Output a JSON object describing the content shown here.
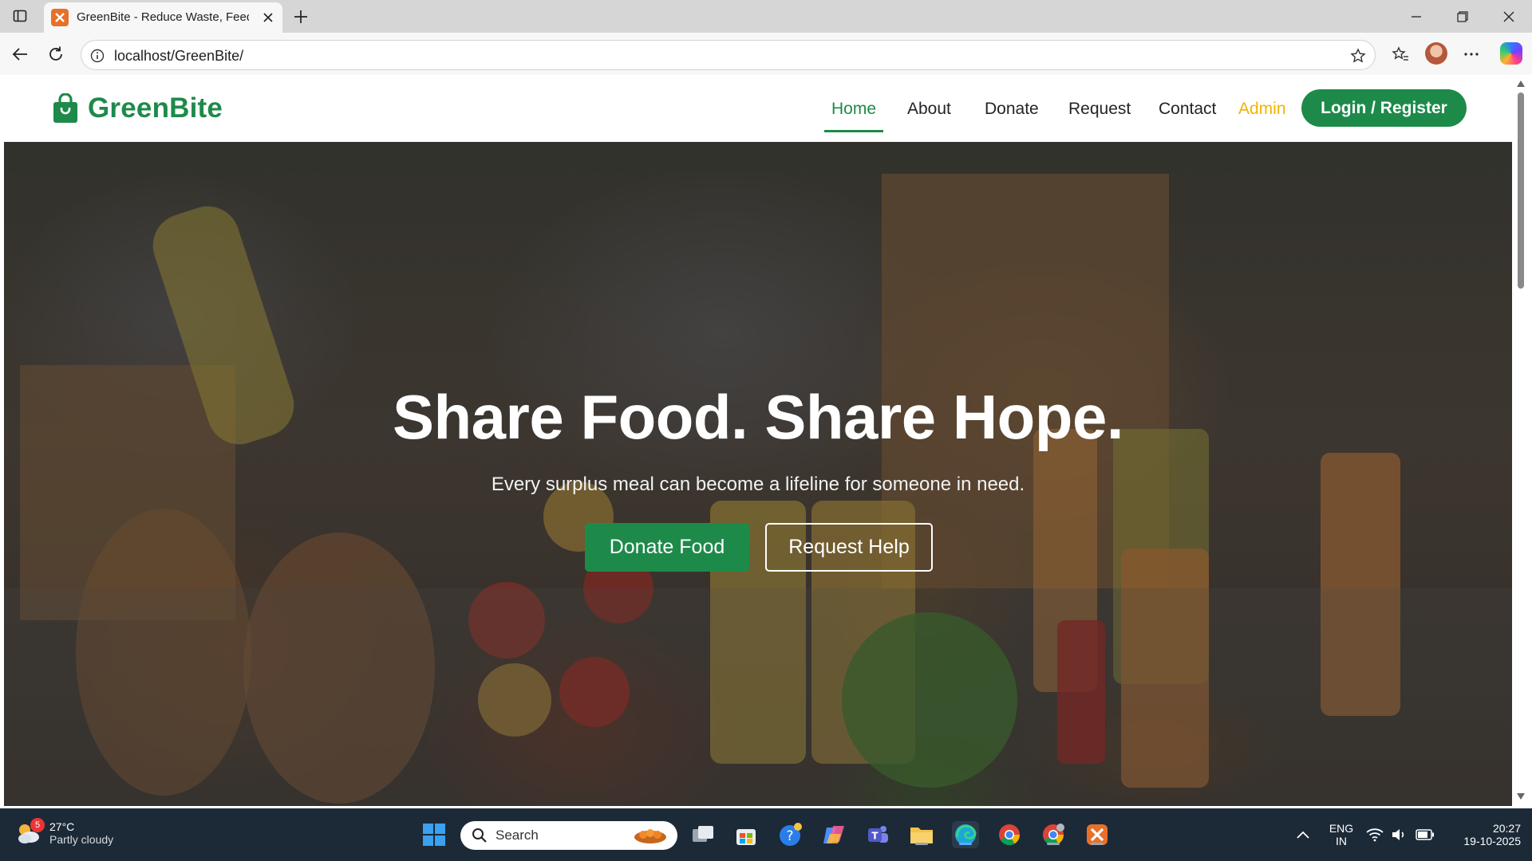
{
  "browser": {
    "tab_title": "GreenBite - Reduce Waste, Feed Lives",
    "url": "localhost/GreenBite/"
  },
  "site": {
    "brand": "GreenBite",
    "nav": {
      "home": "Home",
      "about": "About",
      "donate": "Donate",
      "request": "Request",
      "contact": "Contact",
      "admin": "Admin",
      "login": "Login / Register"
    },
    "hero": {
      "title": "Share Food. Share Hope.",
      "subtitle": "Every surplus meal can become a lifeline for someone in need.",
      "donate_button": "Donate Food",
      "request_button": "Request Help"
    }
  },
  "taskbar": {
    "weather_temp": "27°C",
    "weather_desc": "Partly cloudy",
    "weather_badge": "5",
    "search_label": "Search",
    "lang_1": "ENG",
    "lang_2": "IN",
    "time": "20:27",
    "date": "19-10-2025"
  },
  "colors": {
    "brand_green": "#1e8a4a",
    "admin_yellow": "#f0b400"
  }
}
